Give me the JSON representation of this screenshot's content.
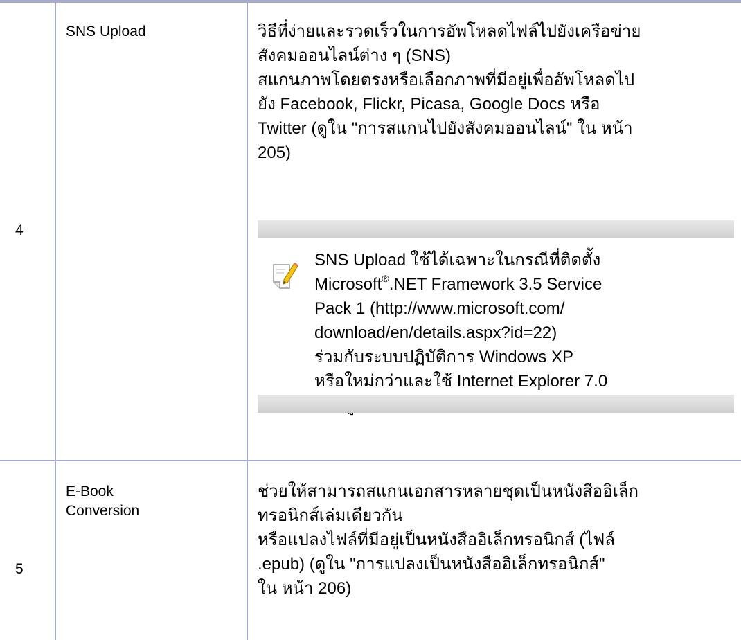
{
  "colors": {
    "rule": "#a7a9c9",
    "note_bar": "#d6d6d6",
    "icon_pencil": "#f0c419"
  },
  "rows": [
    {
      "number": "4",
      "name": "SNS Upload",
      "description_lines": [
        "วิธีที่ง่ายและรวดเร็วในการอัพโหลดไฟล์ไปยังเครือข่าย",
        "สังคมออนไลน์ต่าง ๆ (SNS)",
        "สแกนภาพโดยตรงหรือเลือกภาพที่มีอยู่เพื่ออัพโหลดไป",
        "ยัง Facebook, Flickr, Picasa, Google Docs หรือ",
        "Twitter (ดูใน \"การสแกนไปยังสังคมออนไลน์\"  ใน หน้า",
        "205)"
      ],
      "note": {
        "icon": "note-pencil-icon",
        "line1": "SNS Upload ใช้ได้เฉพาะในกรณีที่ติดตั้ง",
        "line2_before": "Microsoft",
        "line2_sup": "®",
        "line2_after": ".NET Framework 3.5 Service",
        "line3": "Pack 1 (http://www.microsoft.com/",
        "line4": "download/en/details.aspx?id=22)",
        "line5": "ร่วมกับระบบปฏิบัติการ Windows XP",
        "line6": "หรือใหม่กว่าและใช้ Internet Explorer 7.0",
        "line7": "หรือสูงกว่า"
      }
    },
    {
      "number": "5",
      "name": "E-Book Conversion",
      "name_line1": "E-Book",
      "name_line2": "Conversion",
      "description_lines": [
        "ช่วยให้สามารถสแกนเอกสารหลายชุดเป็นหนังสืออิเล็ก",
        "ทรอนิกส์เล่มเดียวกัน",
        "หรือแปลงไฟล์ที่มีอยู่เป็นหนังสืออิเล็กทรอนิกส์ (ไฟล์",
        ".epub) (ดูใน \"การแปลงเป็นหนังสืออิเล็กทรอนิกส์\"",
        "ใน หน้า 206)"
      ]
    }
  ]
}
